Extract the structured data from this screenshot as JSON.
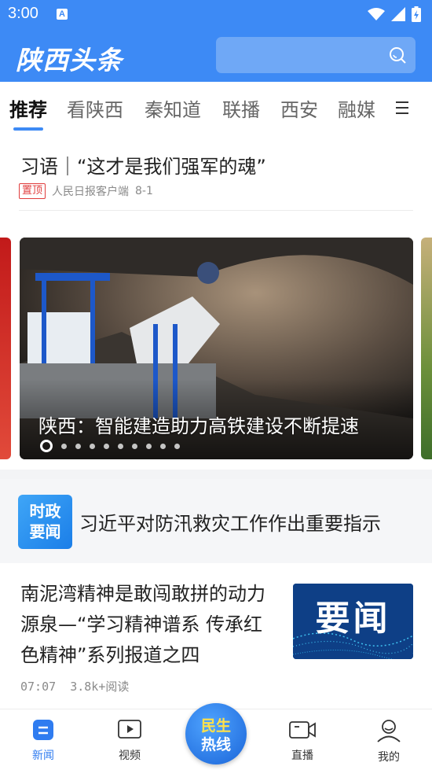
{
  "status_bar": {
    "time": "3:00",
    "notification_icon": "A"
  },
  "app_bar": {
    "logo_text": "陕西头条",
    "search_icon": "search-icon"
  },
  "tabs": [
    {
      "label": "推荐",
      "active": true
    },
    {
      "label": "看陕西",
      "active": false
    },
    {
      "label": "秦知道",
      "active": false
    },
    {
      "label": "联播",
      "active": false
    },
    {
      "label": "西安",
      "active": false
    },
    {
      "label": "融媒",
      "active": false
    }
  ],
  "pinned": {
    "title": "习语｜“这才是我们强军的魂”",
    "badge": "置顶",
    "source": "人民日报客户端",
    "date": "8-1"
  },
  "carousel": {
    "caption": "陕西：智能建造助力高铁建设不断提速",
    "slide_count": 10,
    "active_index": 0
  },
  "politics": {
    "badge_line1": "时政",
    "badge_line2": "要闻",
    "headline": "习近平对防汛救灾工作作出重要指示"
  },
  "article": {
    "title": "南泥湾精神是敢闯敢拼的动力源泉—“学习精神谱系  传承红色精神”系列报道之四",
    "time": "07:07",
    "reads": "3.8k+阅读",
    "thumb_text": "要闻"
  },
  "bottom_nav": {
    "items": [
      {
        "label": "新闻",
        "icon": "news-icon",
        "active": true
      },
      {
        "label": "视频",
        "icon": "video-icon",
        "active": false
      },
      {
        "label": "直播",
        "icon": "live-icon",
        "active": false
      },
      {
        "label": "我的",
        "icon": "profile-icon",
        "active": false
      }
    ],
    "center_line1": "民生",
    "center_line2": "热线"
  },
  "colors": {
    "brand_blue": "#3d8af5",
    "pin_red": "#e03c3c"
  }
}
